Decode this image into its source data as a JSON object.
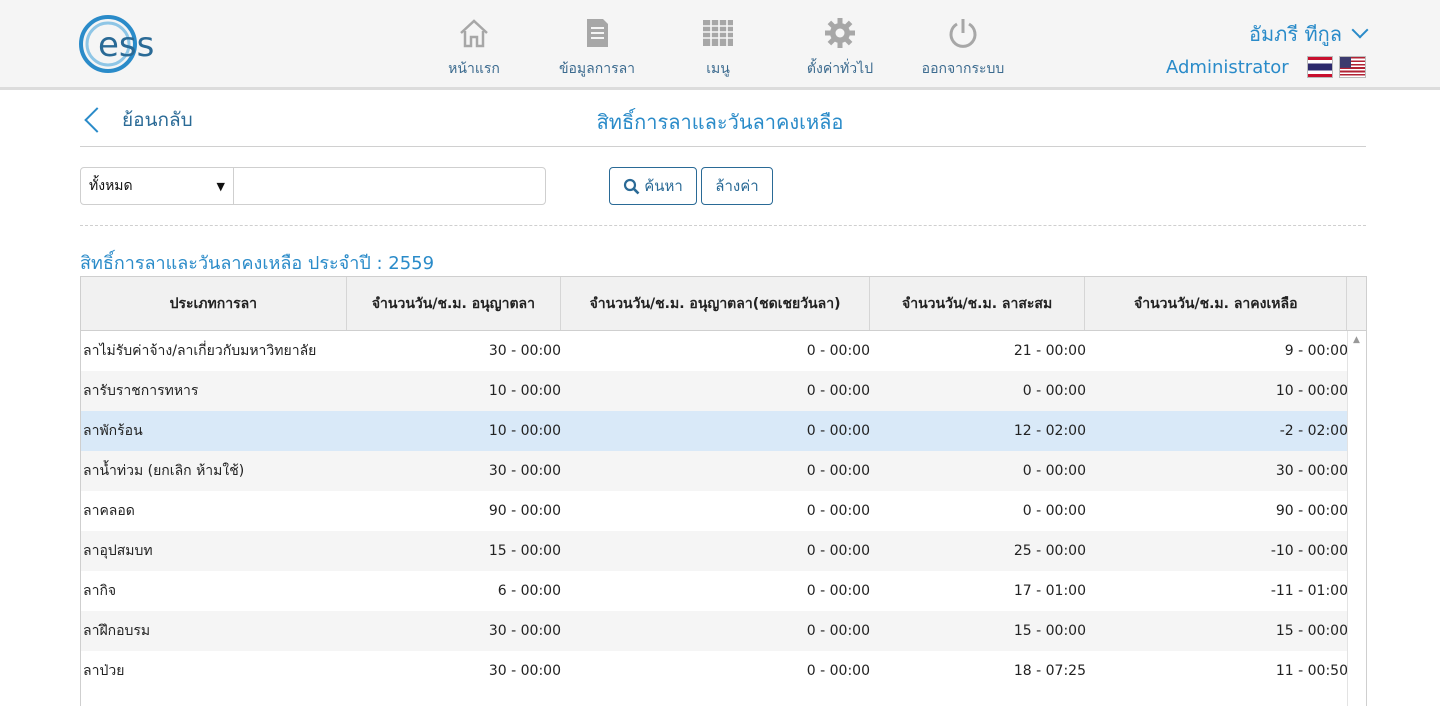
{
  "header": {
    "logo_text": "ess",
    "nav": [
      {
        "label": "หน้าแรก",
        "icon": "home-icon"
      },
      {
        "label": "ข้อมูลการลา",
        "icon": "document-icon"
      },
      {
        "label": "เมนู",
        "icon": "grid-icon"
      },
      {
        "label": "ตั้งค่าทั่วไป",
        "icon": "gear-icon"
      },
      {
        "label": "ออกจากระบบ",
        "icon": "power-icon"
      }
    ],
    "user_name": "อัมภรี ทีกูล",
    "user_role": "Administrator"
  },
  "page": {
    "back_label": "ย้อนกลับ",
    "title": "สิทธิ์การลาและวันลาคงเหลือ"
  },
  "search": {
    "filter_value": "ทั้งหมด",
    "input_value": "",
    "input_placeholder": "",
    "search_label": "ค้นหา",
    "clear_label": "ล้างค่า"
  },
  "section": {
    "title": "สิทธิ์การลาและวันลาคงเหลือ ประจำปี : 2559"
  },
  "table": {
    "columns": [
      "ประเภทการลา",
      "จำนวนวัน/ช.ม. อนุญาตลา",
      "จำนวนวัน/ช.ม. อนุญาตลา(ชดเชยวันลา)",
      "จำนวนวัน/ช.ม. ลาสะสม",
      "จำนวนวัน/ช.ม. ลาคงเหลือ"
    ],
    "rows": [
      [
        "ลาไม่รับค่าจ้าง/ลาเกี่ยวกับมหาวิทยาลัย",
        "30 - 00:00",
        "0 - 00:00",
        "21 - 00:00",
        "9 - 00:00"
      ],
      [
        "ลารับราชการทหาร",
        "10 - 00:00",
        "0 - 00:00",
        "0 - 00:00",
        "10 - 00:00"
      ],
      [
        "ลาพักร้อน",
        "10 - 00:00",
        "0 - 00:00",
        "12 - 02:00",
        "-2 - 02:00"
      ],
      [
        "ลาน้ำท่วม (ยกเลิก ห้ามใช้)",
        "30 - 00:00",
        "0 - 00:00",
        "0 - 00:00",
        "30 - 00:00"
      ],
      [
        "ลาคลอด",
        "90 - 00:00",
        "0 - 00:00",
        "0 - 00:00",
        "90 - 00:00"
      ],
      [
        "ลาอุปสมบท",
        "15 - 00:00",
        "0 - 00:00",
        "25 - 00:00",
        "-10 - 00:00"
      ],
      [
        "ลากิจ",
        "6 - 00:00",
        "0 - 00:00",
        "17 - 01:00",
        "-11 - 01:00"
      ],
      [
        "ลาฝึกอบรม",
        "30 - 00:00",
        "0 - 00:00",
        "15 - 00:00",
        "15 - 00:00"
      ],
      [
        "ลาป่วย",
        "30 - 00:00",
        "0 - 00:00",
        "18 - 07:25",
        "11 - 00:50"
      ]
    ],
    "selected_row": 2
  },
  "colors": {
    "accent": "#2a8bc9",
    "nav_text": "#3c6b8f",
    "selected_row": "#d9e9f8",
    "header_bg": "#f5f5f5"
  }
}
